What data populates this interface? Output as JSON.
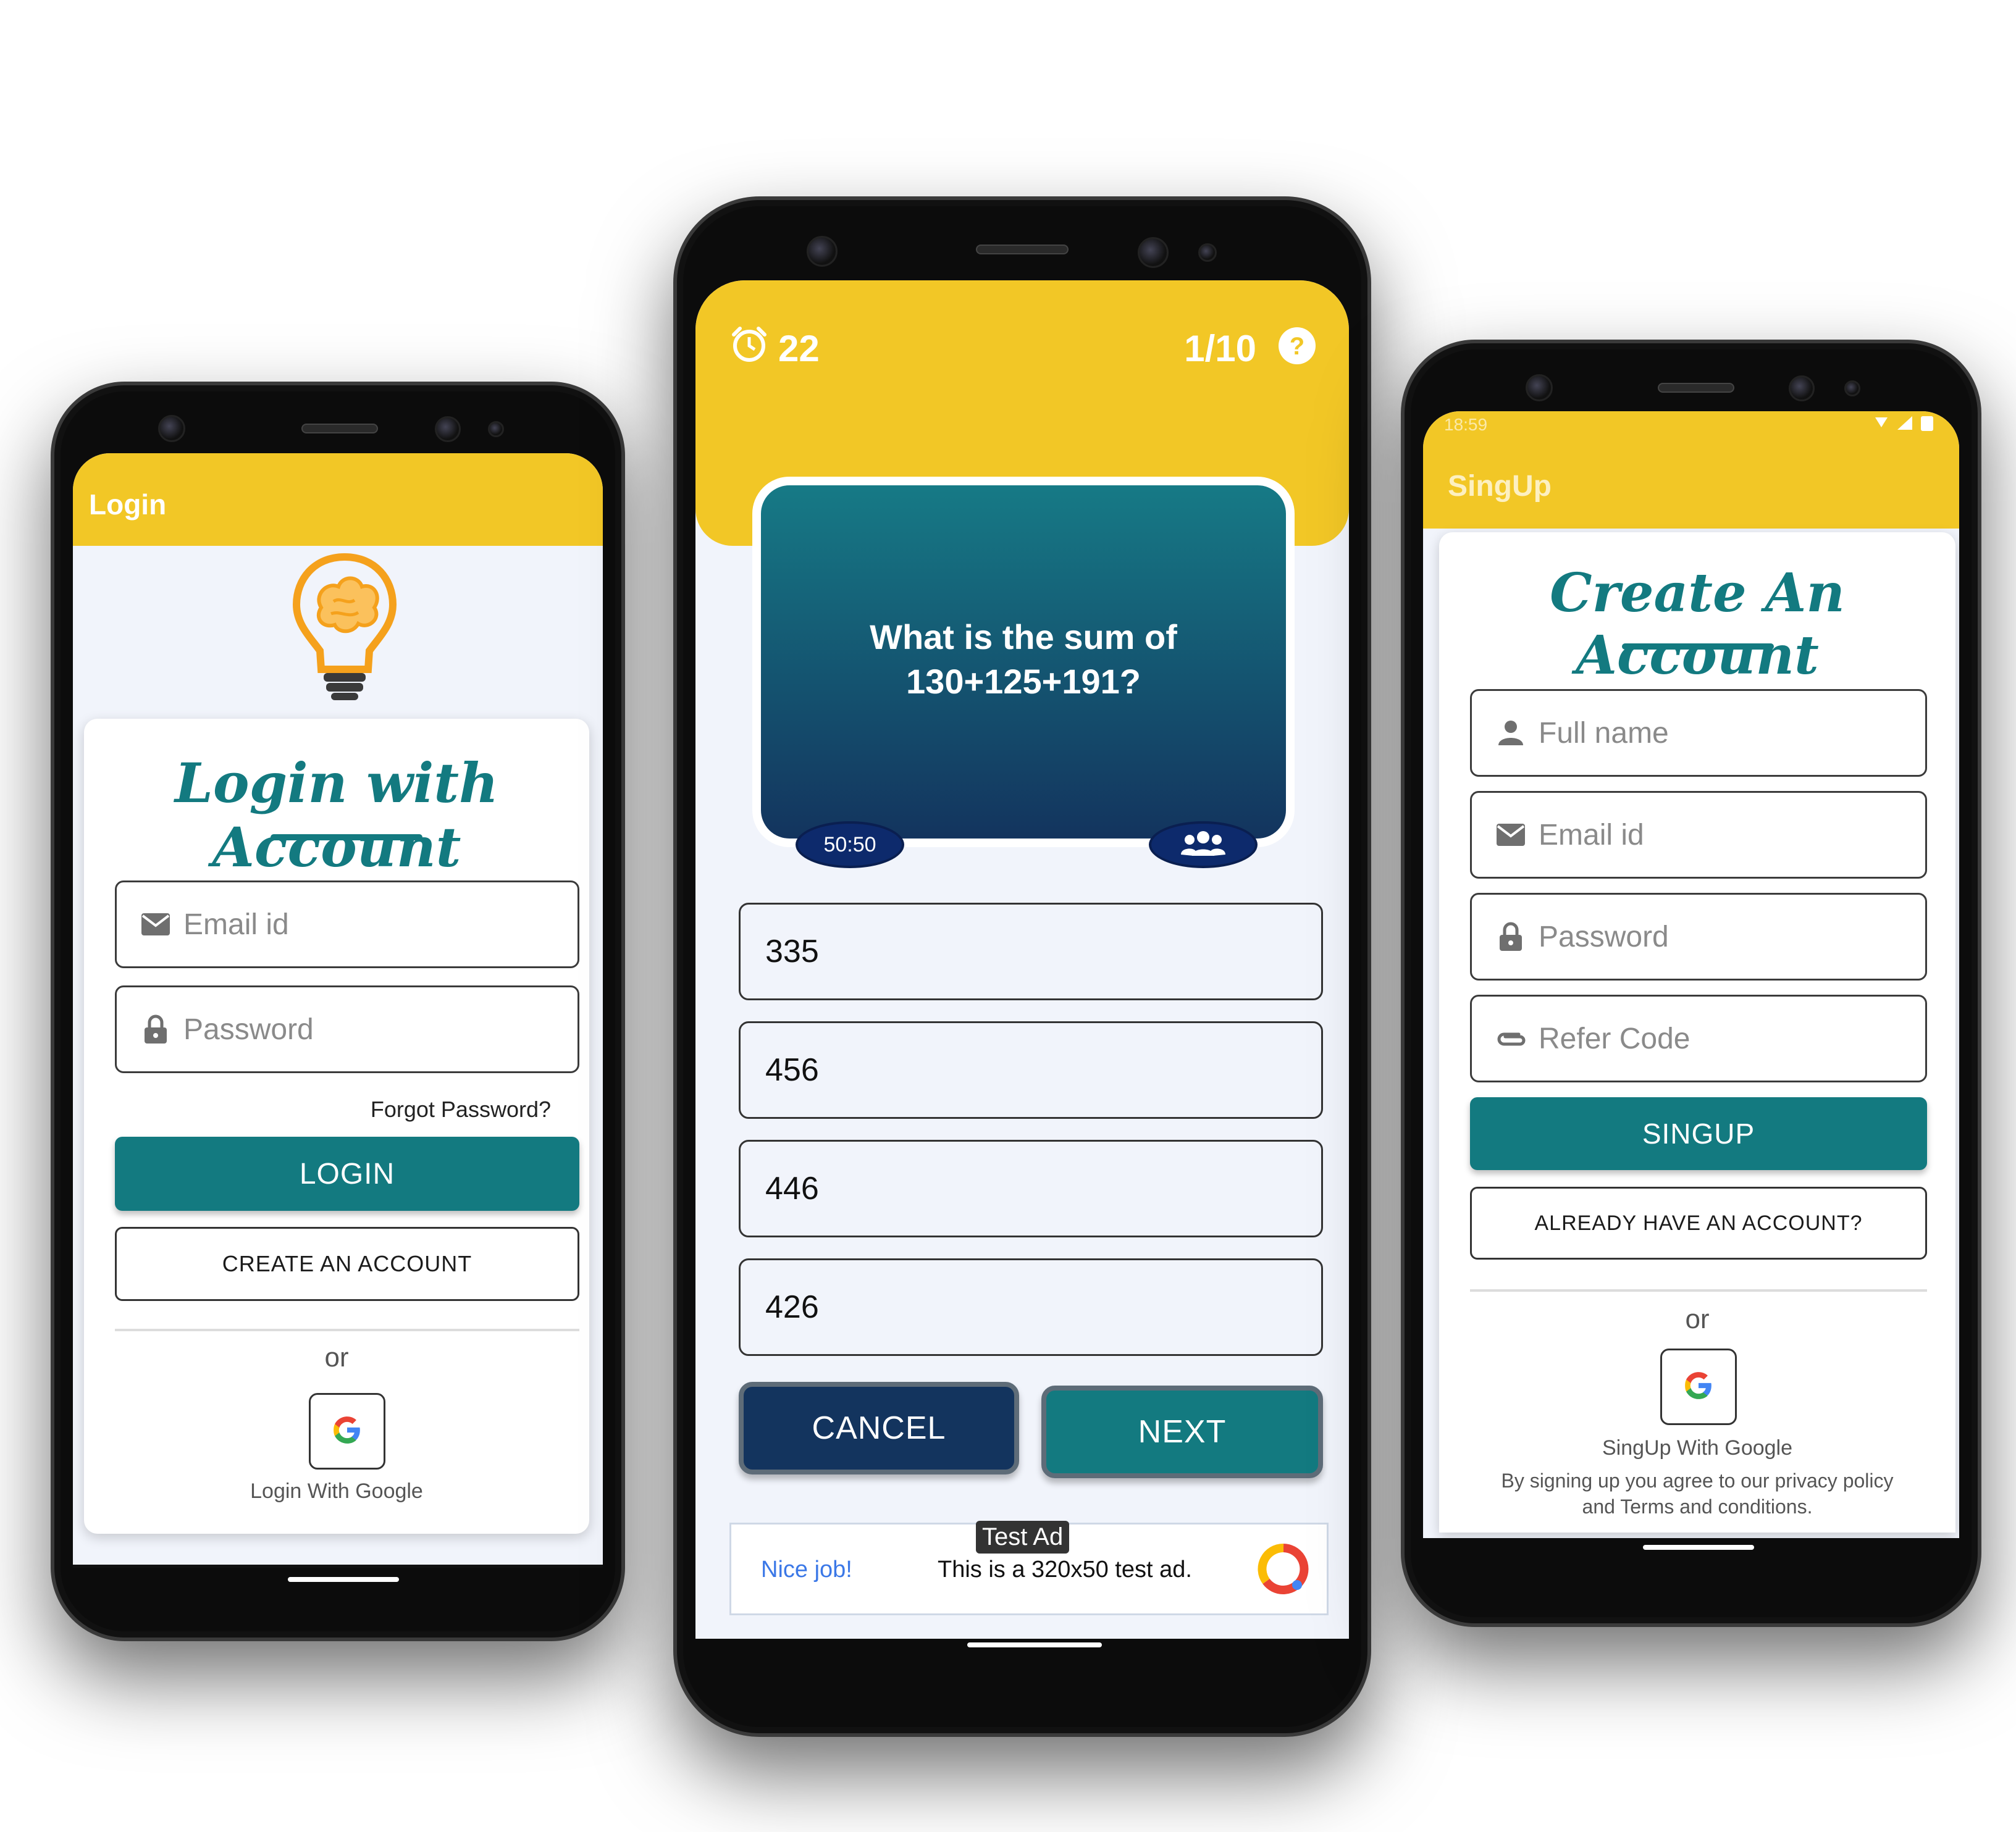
{
  "login_screen": {
    "appbar_title": "Login",
    "heading": "Login with Account",
    "email_placeholder": "Email id",
    "password_placeholder": "Password",
    "forgot_password": "Forgot Password?",
    "login_button": "LOGIN",
    "create_account_button": "CREATE AN ACCOUNT",
    "or_text": "or",
    "google_label": "Login With Google",
    "icons": [
      "bulb-brain-logo",
      "email-icon",
      "lock-icon",
      "google-icon"
    ]
  },
  "quiz_screen": {
    "timer": "22",
    "progress": "1/10",
    "question": "What is the sum of 130+125+191?",
    "lifeline_fifty": "50:50",
    "answers": [
      "335",
      "456",
      "446",
      "426"
    ],
    "cancel_button": "CANCEL",
    "next_button": "NEXT",
    "ad": {
      "badge": "Test Ad",
      "nice_job": "Nice job!",
      "text": "This is a 320x50 test ad."
    },
    "icons": [
      "alarm-clock-icon",
      "help-icon",
      "audience-icon",
      "ad-logo-icon"
    ]
  },
  "signup_screen": {
    "status_time": "18:59",
    "appbar_title": "SingUp",
    "heading": "Create An Account",
    "fullname_placeholder": "Full name",
    "email_placeholder": "Email id",
    "password_placeholder": "Password",
    "refer_placeholder": "Refer Code",
    "signup_button": "SINGUP",
    "already_button": "ALREADY HAVE AN ACCOUNT?",
    "or_text": "or",
    "google_label": "SingUp With Google",
    "terms_line1": "By signing up you agree to our privacy policy",
    "terms_line2": "and Terms and conditions.",
    "icons": [
      "person-icon",
      "email-icon",
      "lock-icon",
      "attachment-icon",
      "google-icon"
    ]
  },
  "colors": {
    "accent_yellow": "#f2c726",
    "teal": "#137a80",
    "navy": "#13345e",
    "background": "#f1f4fb"
  }
}
